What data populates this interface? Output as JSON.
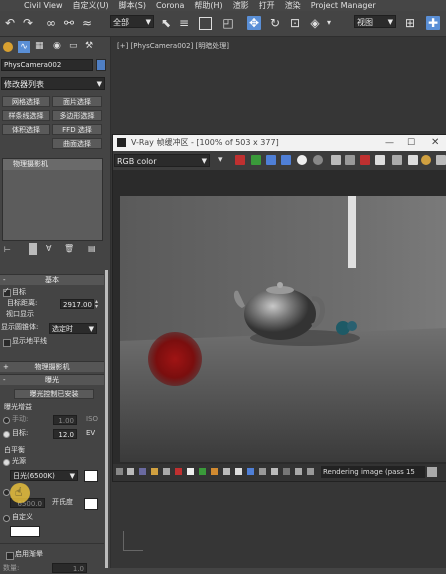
{
  "menu": {
    "items": [
      "Civil View",
      "自定义(U)",
      "脚本(S)",
      "Corona",
      "帮助(H)",
      "渲影",
      "打开",
      "渲染",
      "Project Manager"
    ]
  },
  "toolbar": {
    "selection_filter": "全部",
    "view_dropdown": "视图"
  },
  "panel": {
    "object_name": "PhysCamera002",
    "modifier_list": "修改器列表",
    "buttons": [
      "网格选择",
      "面片选择",
      "样条线选择",
      "多边形选择",
      "体积选择",
      "FFD 选择",
      "曲面选择"
    ],
    "stack_item": "物理摄影机",
    "basic": {
      "rollout_title": "基本",
      "target_checkbox": "目标",
      "target_distance_label": "目标距离:",
      "target_distance_value": "2917.00",
      "viewport_display_title": "视口显示",
      "show_cone_label": "显示圆锥体:",
      "show_cone_value": "选定时",
      "show_horizon_label": "显示地平线"
    },
    "physical_camera_rollout": "物理摄影机",
    "exposure": {
      "rollout_title": "曝光",
      "exposure_control_button": "曝光控制已安装",
      "gain_title": "曝光增益",
      "manual_label": "手动:",
      "manual_value": "1.00",
      "manual_unit": "ISO",
      "target_label": "目标:",
      "target_value": "12.0",
      "target_unit": "EV",
      "white_balance_title": "白平衡",
      "illuminant_label": "光源",
      "illuminant_value": "日光(6500K)",
      "temperature_value": "6500.0",
      "temperature_unit": "开氏度",
      "custom_label": "自定义",
      "vignetting_label": "启用渐晕",
      "amount_label": "数量:",
      "amount_value": "1.0"
    }
  },
  "viewport": {
    "label": "[+] [PhysCamera002] [明暗处理]"
  },
  "vray": {
    "title": "V-Ray 帧缓冲区 - [100% of 503 x 377]",
    "channel": "RGB color",
    "status": "Rendering image (pass 15"
  },
  "colors": {
    "accent": "#5a8fd6",
    "red_sphere": "#8a1010",
    "blue_sphere": "#1e5a66"
  }
}
